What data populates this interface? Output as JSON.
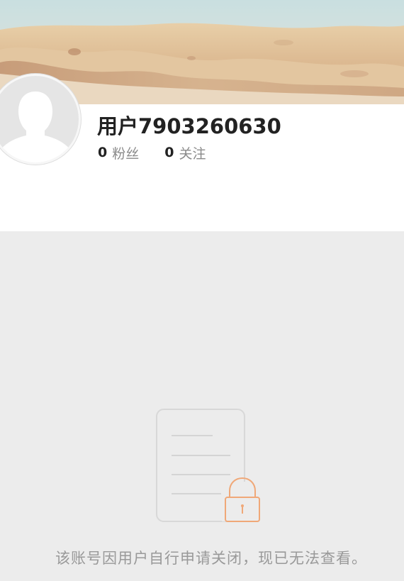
{
  "profile": {
    "username": "用户7903260630",
    "followers_count": "0",
    "followers_label": "粉丝",
    "following_count": "0",
    "following_label": "关注"
  },
  "cover": {
    "image": "sand-beach-photo"
  },
  "avatar": {
    "icon": "default-user-silhouette-icon"
  },
  "account_status": {
    "icon": "document-lock-icon",
    "message": "该账号因用户自行申请关闭，现已无法查看。"
  },
  "colors": {
    "background": "#ececec",
    "card": "#ffffff",
    "lock_accent": "#f0a878",
    "muted_text": "#999999"
  }
}
